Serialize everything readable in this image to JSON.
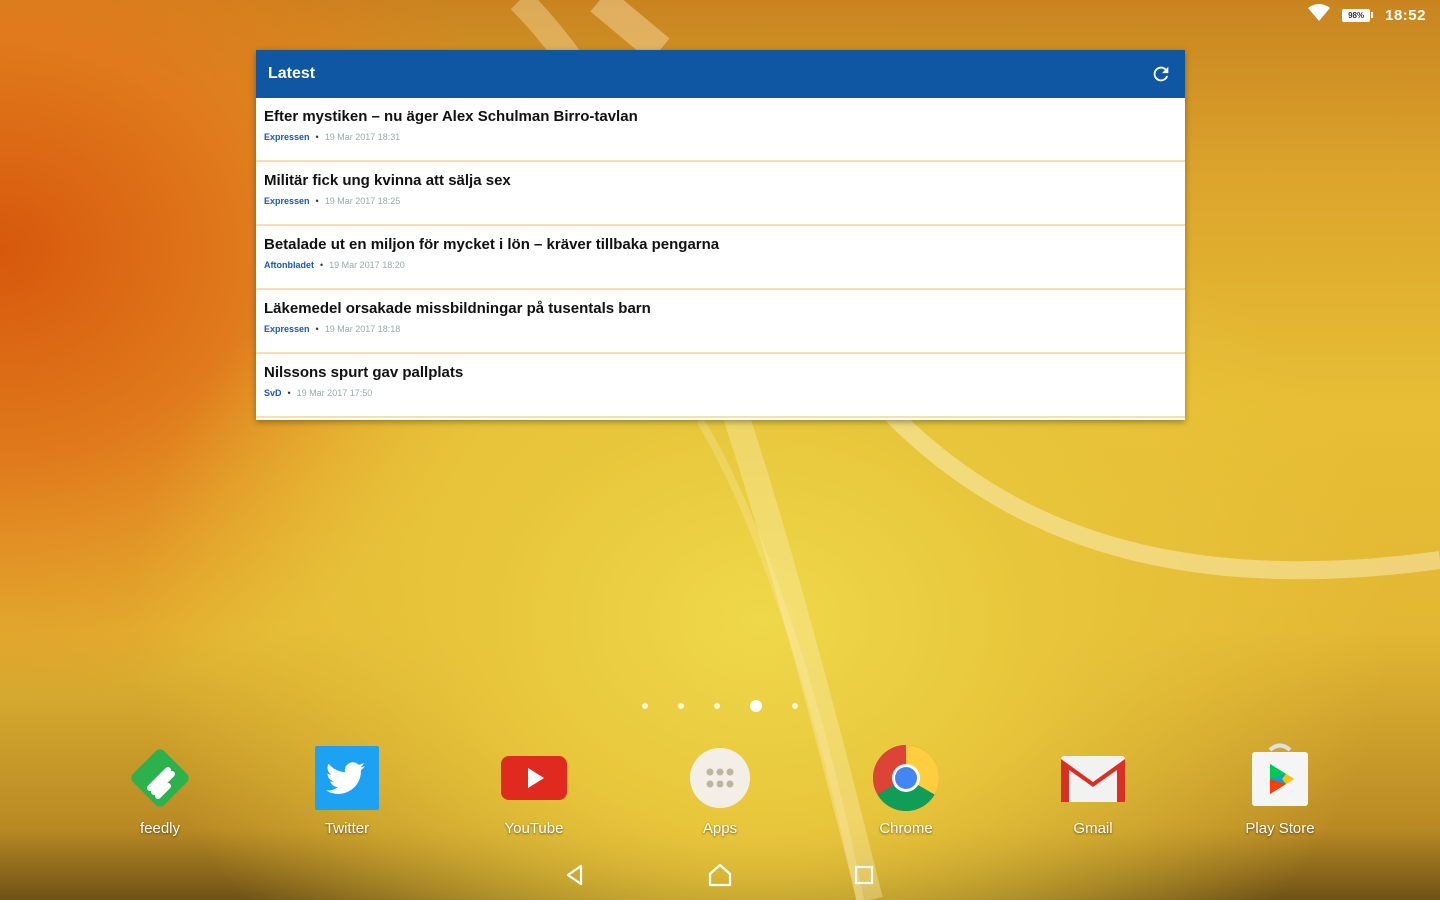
{
  "status_bar": {
    "battery": "98%",
    "time": "18:52"
  },
  "widget": {
    "title": "Latest",
    "items": [
      {
        "title": "Efter mystiken – nu äger Alex Schulman Birro-tavlan",
        "source": "Expressen",
        "date": "19 Mar 2017 18:31"
      },
      {
        "title": "Militär fick ung kvinna att sälja sex",
        "source": "Expressen",
        "date": "19 Mar 2017 18:25"
      },
      {
        "title": "Betalade ut en miljon för mycket i lön – kräver tillbaka pengarna",
        "source": "Aftonbladet",
        "date": "19 Mar 2017 18:20"
      },
      {
        "title": "Läkemedel orsakade missbildningar på tusentals barn",
        "source": "Expressen",
        "date": "19 Mar 2017 18:18"
      },
      {
        "title": "Nilssons spurt gav pallplats",
        "source": "SvD",
        "date": "19 Mar 2017 17:50"
      }
    ],
    "separator": "•"
  },
  "dock": {
    "apps": [
      {
        "label": "feedly",
        "icon": "feedly-icon"
      },
      {
        "label": "Twitter",
        "icon": "twitter-icon"
      },
      {
        "label": "YouTube",
        "icon": "youtube-icon"
      },
      {
        "label": "Apps",
        "icon": "apps-drawer-icon"
      },
      {
        "label": "Chrome",
        "icon": "chrome-icon"
      },
      {
        "label": "Gmail",
        "icon": "gmail-icon"
      },
      {
        "label": "Play Store",
        "icon": "play-store-icon"
      }
    ]
  },
  "page_indicator": {
    "count": 5,
    "active_index": 3
  },
  "colors": {
    "widget_header": "#0f56a3",
    "source_link": "#1a57b8"
  }
}
